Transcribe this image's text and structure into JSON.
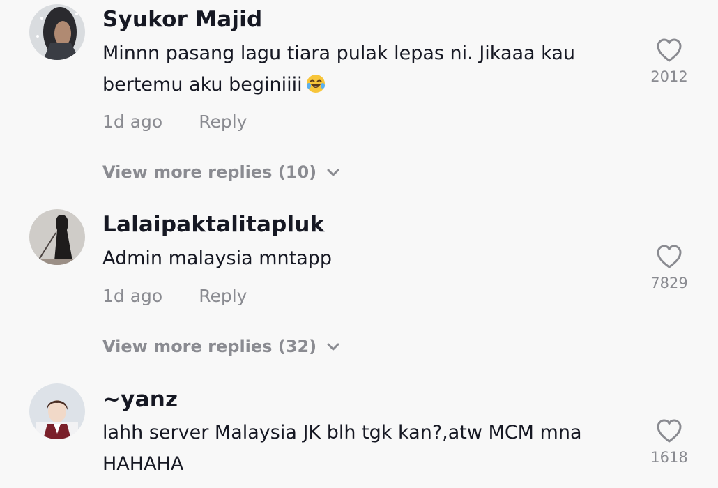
{
  "comments": [
    {
      "author": "Syukor Majid",
      "text": "Minnn pasang lagu tiara pulak lepas ni. Jikaaa kau bertemu aku beginiiii",
      "emoji": "face-with-tears-of-joy",
      "time": "1d ago",
      "reply_label": "Reply",
      "likes": "2012",
      "view_more": "View more replies (10)"
    },
    {
      "author": "Lalaipaktalitapluk",
      "text": "Admin malaysia mntapp",
      "time": "1d ago",
      "reply_label": "Reply",
      "likes": "7829",
      "view_more": "View more replies (32)"
    },
    {
      "author": "~yanz",
      "text": "lahh server Malaysia JK blh tgk kan?,atw MCM mna HAHAHA",
      "likes": "1618"
    }
  ],
  "icons": {
    "like": "heart-outline-icon",
    "expand": "chevron-down-icon"
  },
  "colors": {
    "background": "#f8f8f8",
    "primary_text": "#161823",
    "secondary_text": "#8a8b91"
  }
}
